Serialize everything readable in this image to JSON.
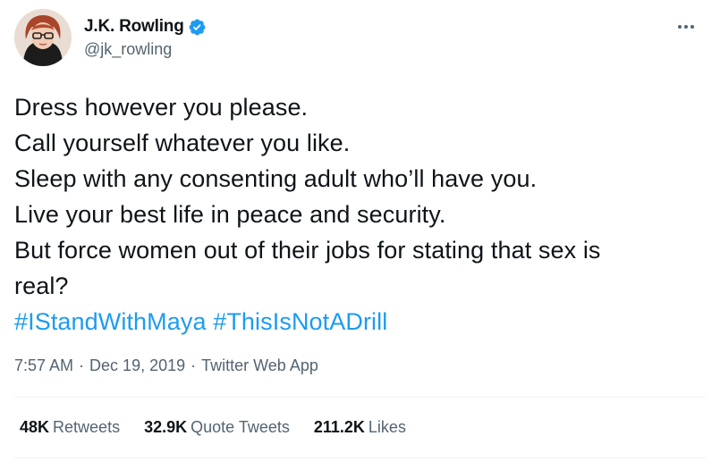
{
  "author": {
    "display_name": "J.K. Rowling",
    "handle": "@jk_rowling",
    "verified": true
  },
  "tweet": {
    "lines": [
      "Dress however you please.",
      "Call yourself whatever you like.",
      "Sleep with any consenting adult who’ll have you.",
      "Live your best life in peace and security.",
      "But force women out of their jobs for stating that sex is",
      "real?"
    ],
    "hashtags": [
      "#IStandWithMaya",
      "#ThisIsNotADrill"
    ]
  },
  "meta": {
    "time": "7:57 AM",
    "date": "Dec 19, 2019",
    "source": "Twitter Web App",
    "separator": "·"
  },
  "stats": {
    "retweets_count": "48K",
    "retweets_label": "Retweets",
    "quotes_count": "32.9K",
    "quotes_label": "Quote Tweets",
    "likes_count": "211.2K",
    "likes_label": "Likes"
  },
  "colors": {
    "link": "#1d9bf0",
    "secondary_text": "#536471",
    "primary_text": "#0f1419",
    "divider": "#eff3f4",
    "verified_badge": "#1d9bf0"
  },
  "icons": [
    "avatar",
    "verified-badge-icon",
    "more-options-icon"
  ]
}
